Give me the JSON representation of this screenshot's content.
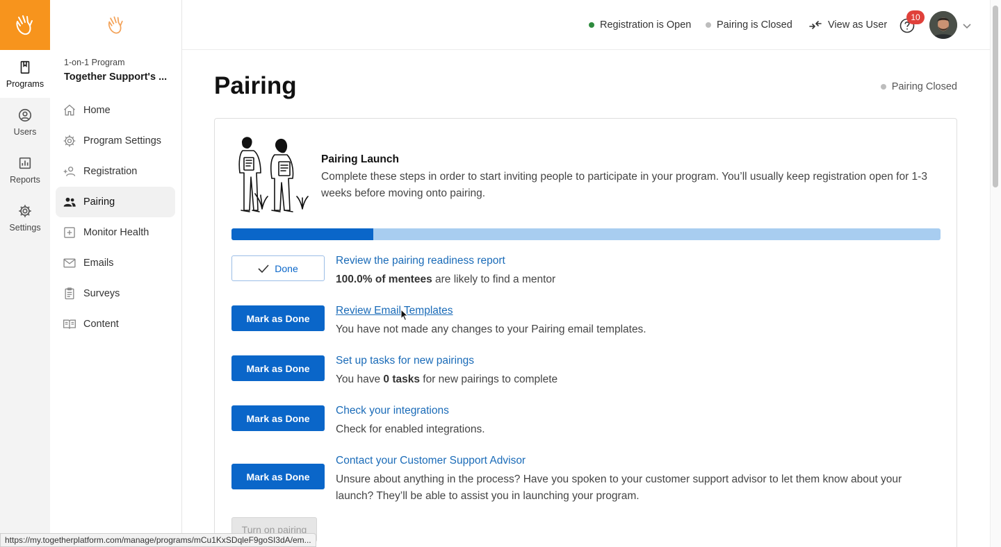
{
  "rail": {
    "items": [
      {
        "label": "Programs",
        "icon": "bookmark-icon",
        "active": true
      },
      {
        "label": "Users",
        "icon": "user-circle-icon"
      },
      {
        "label": "Reports",
        "icon": "chart-icon"
      },
      {
        "label": "Settings",
        "icon": "gear-icon"
      }
    ],
    "brand_color": "#f7941d"
  },
  "sidebar": {
    "program_kind": "1-on-1 Program",
    "program_name": "Together Support's ...",
    "items": [
      {
        "label": "Home",
        "icon": "home-icon"
      },
      {
        "label": "Program Settings",
        "icon": "gear-icon"
      },
      {
        "label": "Registration",
        "icon": "add-user-icon"
      },
      {
        "label": "Pairing",
        "icon": "users-icon",
        "active": true
      },
      {
        "label": "Monitor Health",
        "icon": "plus-square-icon"
      },
      {
        "label": "Emails",
        "icon": "mail-icon"
      },
      {
        "label": "Surveys",
        "icon": "clipboard-icon"
      },
      {
        "label": "Content",
        "icon": "book-icon"
      }
    ]
  },
  "topbar": {
    "registration_status": "Registration is Open",
    "pairing_status": "Pairing is Closed",
    "view_as_user": "View as User",
    "notification_count": "10",
    "open_color": "#2e8b3e",
    "closed_color": "#bdbdbd"
  },
  "main": {
    "title": "Pairing",
    "status": "Pairing Closed",
    "launch": {
      "title": "Pairing Launch",
      "description": "Complete these steps in order to start inviting people to participate in your program. You’ll usually keep registration open for 1-3 weeks before moving onto pairing.",
      "progress": 0.2
    },
    "steps": [
      {
        "button": "Done",
        "done": true,
        "link": "Review the pairing readiness report",
        "text_bold": "100.0% of mentees",
        "text_rest": " are likely to find a mentor"
      },
      {
        "button": "Mark as Done",
        "link": "Review Email Templates",
        "text": "You have not made any changes to your Pairing email templates."
      },
      {
        "button": "Mark as Done",
        "link": "Set up tasks for new pairings",
        "text_pre": "You have ",
        "text_bold": "0 tasks",
        "text_rest": " for new pairings to complete"
      },
      {
        "button": "Mark as Done",
        "link": "Check your integrations",
        "text": "Check for enabled integrations."
      },
      {
        "button": "Mark as Done",
        "link": "Contact your Customer Support Advisor",
        "text": "Unsure about anything in the process? Have you spoken to your customer support advisor to let them know about your launch? They’ll be able to assist you in launching your program."
      }
    ],
    "turn_on_label": "Turn on pairing"
  },
  "status_url": "https://my.togetherplatform.com/manage/programs/mCu1KxSDqleF9goSI3dA/em..."
}
